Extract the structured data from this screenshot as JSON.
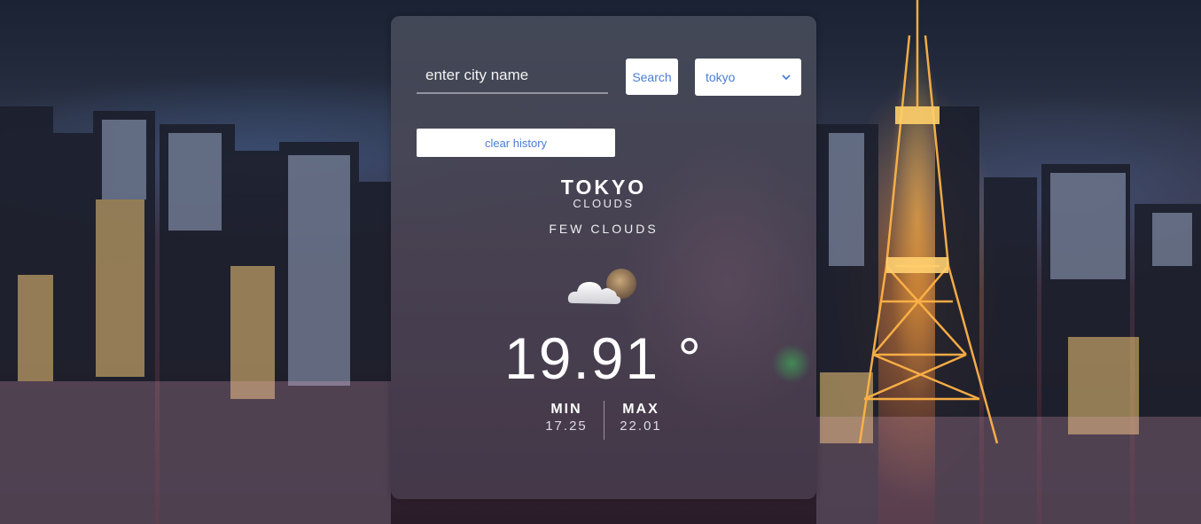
{
  "search": {
    "placeholder": "enter city name",
    "button_label": "Search"
  },
  "city_dropdown": {
    "selected": "tokyo"
  },
  "history": {
    "clear_label": "clear history"
  },
  "weather": {
    "city": "TOKYO",
    "main": "CLOUDS",
    "description": "FEW CLOUDS",
    "icon": "few-clouds-night-icon",
    "temperature": "19.91 °",
    "min_label": "MIN",
    "min_value": "17.25",
    "max_label": "MAX",
    "max_value": "22.01"
  },
  "colors": {
    "accent_text": "#4a7ed6",
    "card_bg": "#4a4656",
    "text": "#ffffff"
  }
}
